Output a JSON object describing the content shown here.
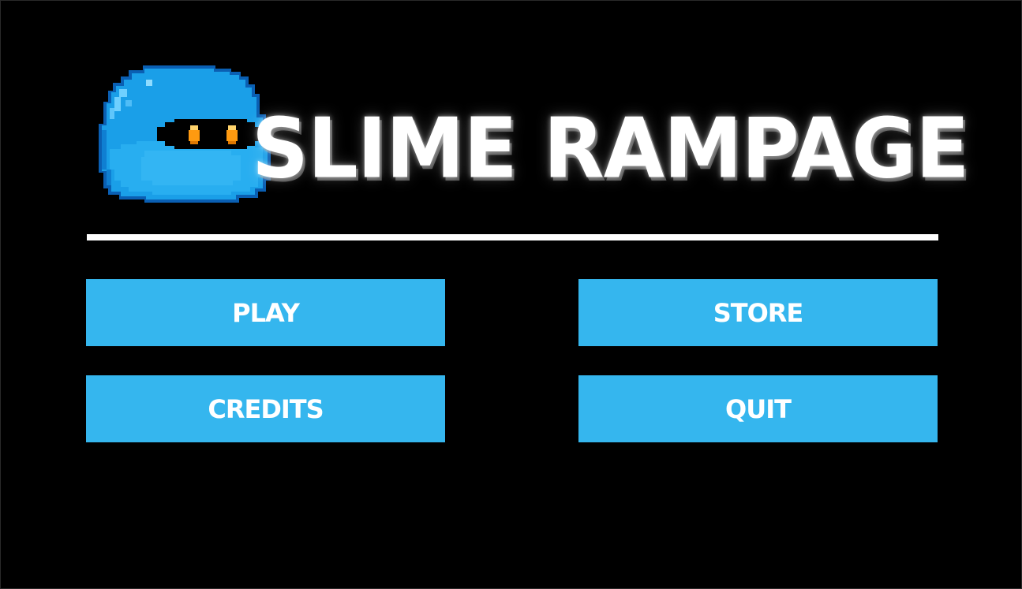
{
  "game": {
    "title": "SLIME RAMPAGE"
  },
  "colors": {
    "background": "#000000",
    "button": "#35b6ee",
    "button_text": "#ffffff",
    "title_text": "#ffffff",
    "divider": "#ffffff",
    "slime_body": "#1a9fe8",
    "slime_highlight": "#6fd0ff",
    "slime_shadow": "#0f6fc4",
    "slime_eye": "#ff9a10"
  },
  "logo": {
    "icon": "blue-slime-icon"
  },
  "menu": {
    "play_label": "PLAY",
    "store_label": "STORE",
    "credits_label": "CREDITS",
    "quit_label": "QUIT"
  }
}
